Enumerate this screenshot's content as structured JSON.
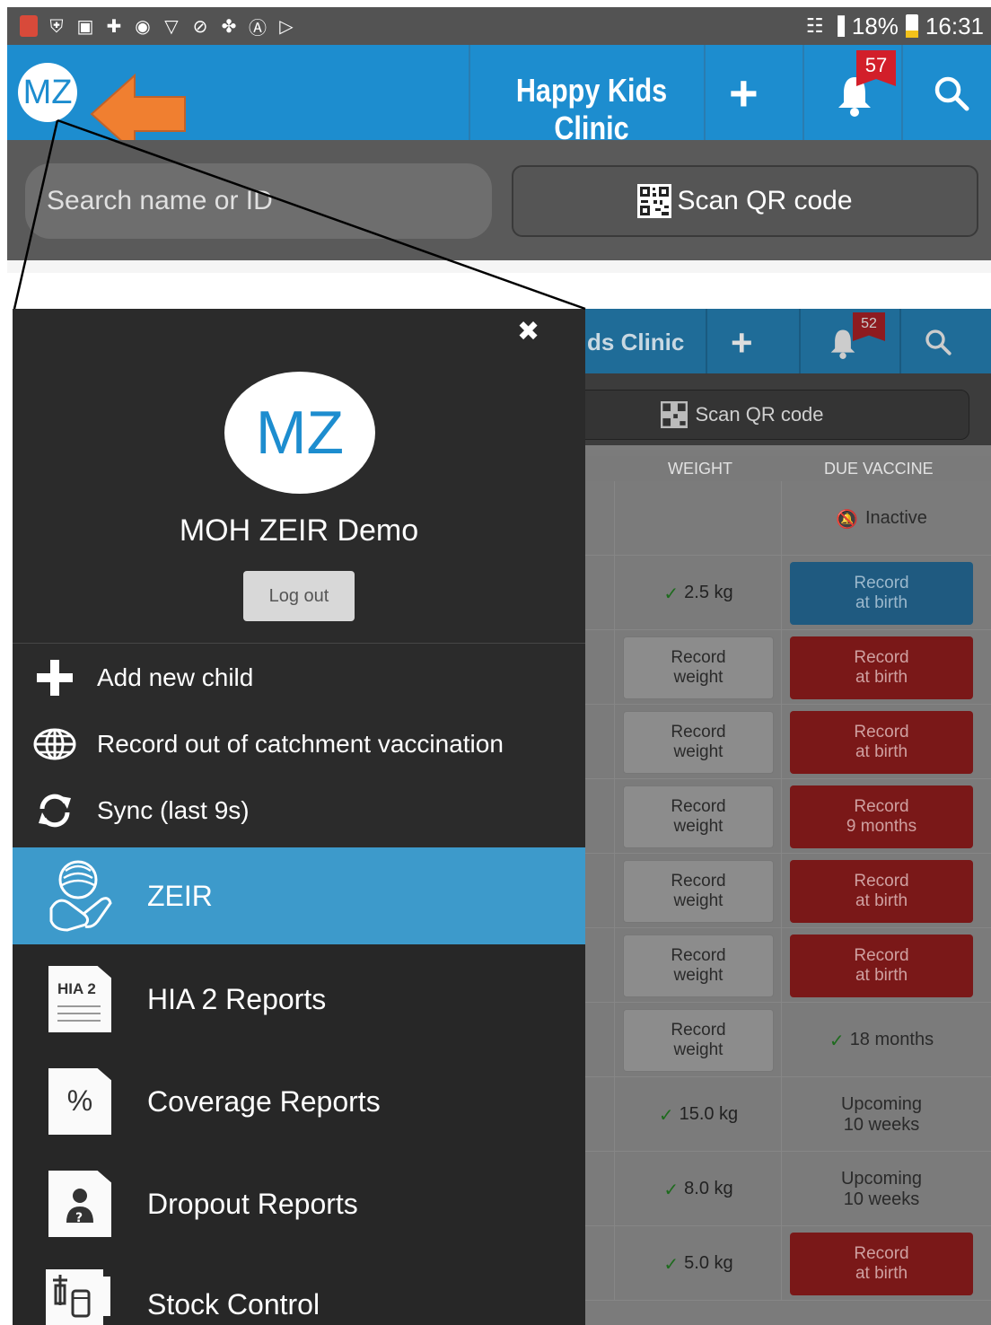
{
  "status_bar": {
    "battery": "18%",
    "time": "16:31"
  },
  "top_app_bar": {
    "avatar_initials": "MZ",
    "clinic_name": "Happy Kids Clinic",
    "notification_count": "57"
  },
  "search": {
    "placeholder": "Search name or ID",
    "scan_qr_label": "Scan QR code"
  },
  "background_app": {
    "clinic_name_partial": "ds Clinic",
    "notification_count": "52",
    "scan_qr_label": "Scan QR code",
    "columns": [
      "WEIGHT",
      "DUE VACCINE"
    ],
    "rows": [
      {
        "weight": "",
        "weight_type": "empty",
        "vaccine": "Inactive",
        "vaccine_type": "inactive"
      },
      {
        "weight": "2.5 kg",
        "weight_type": "done",
        "vaccine": "Record\nat birth",
        "vaccine_type": "blue"
      },
      {
        "weight": "Record\nweight",
        "weight_type": "button",
        "vaccine": "Record\nat birth",
        "vaccine_type": "red"
      },
      {
        "weight": "Record\nweight",
        "weight_type": "button",
        "vaccine": "Record\nat birth",
        "vaccine_type": "red"
      },
      {
        "weight": "Record\nweight",
        "weight_type": "button",
        "vaccine": "Record\n9 months",
        "vaccine_type": "red"
      },
      {
        "weight": "Record\nweight",
        "weight_type": "button",
        "vaccine": "Record\nat birth",
        "vaccine_type": "red"
      },
      {
        "weight": "Record\nweight",
        "weight_type": "button",
        "vaccine": "Record\nat birth",
        "vaccine_type": "red"
      },
      {
        "weight": "Record\nweight",
        "weight_type": "button",
        "vaccine": "18 months",
        "vaccine_type": "done"
      },
      {
        "weight": "15.0 kg",
        "weight_type": "done",
        "vaccine": "Upcoming\n10 weeks",
        "vaccine_type": "text"
      },
      {
        "weight": "8.0 kg",
        "weight_type": "done",
        "vaccine": "Upcoming\n10 weeks",
        "vaccine_type": "text"
      },
      {
        "weight": "5.0 kg",
        "weight_type": "done",
        "vaccine": "Record\nat birth",
        "vaccine_type": "red"
      }
    ]
  },
  "drawer": {
    "avatar_initials": "MZ",
    "user_name": "MOH ZEIR Demo",
    "logout_label": "Log out",
    "actions": [
      {
        "label": "Add new child",
        "icon": "plus-icon"
      },
      {
        "label": "Record out of catchment vaccination",
        "icon": "globe-icon"
      },
      {
        "label": "Sync (last 9s)",
        "icon": "sync-icon"
      }
    ],
    "nav": [
      {
        "label": "ZEIR",
        "icon": "baby-hands-icon",
        "active": true
      },
      {
        "label": "HIA 2 Reports",
        "icon": "hia2-document-icon",
        "icon_text": "HIA 2",
        "active": false
      },
      {
        "label": "Coverage Reports",
        "icon": "percent-document-icon",
        "icon_text": "%",
        "active": false
      },
      {
        "label": "Dropout Reports",
        "icon": "person-question-document-icon",
        "active": false
      },
      {
        "label": "Stock Control",
        "icon": "stock-vial-icon",
        "active": false
      }
    ]
  },
  "colors": {
    "app_bar": "#1d8dcf",
    "drawer_bg": "#2b2b2b",
    "active_nav": "#3d9acb",
    "annotation_arrow": "#f07f30",
    "badge": "#d21f2a"
  }
}
